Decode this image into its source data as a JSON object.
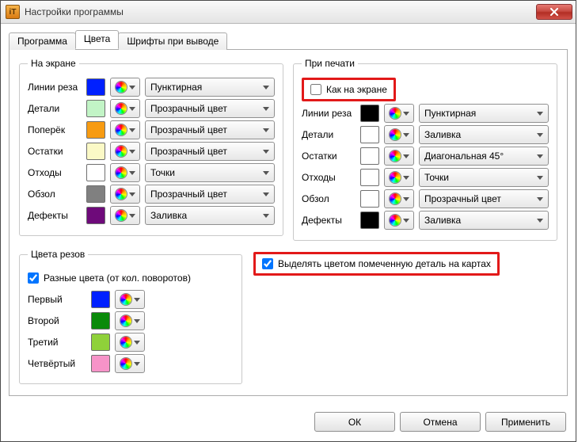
{
  "window": {
    "title": "Настройки программы"
  },
  "tabs": [
    {
      "label": "Программа"
    },
    {
      "label": "Цвета"
    },
    {
      "label": "Шрифты при выводе"
    }
  ],
  "groups": {
    "screen_title": "На экране",
    "print_title": "При печати",
    "cuts_title": "Цвета резов"
  },
  "screen_rows": [
    {
      "label": "Линии реза",
      "color": "#0020ff",
      "style": "Пунктирная"
    },
    {
      "label": "Детали",
      "color": "#c2f4c6",
      "style": "Прозрачный цвет"
    },
    {
      "label": "Поперёк",
      "color": "#f79b12",
      "style": "Прозрачный цвет"
    },
    {
      "label": "Остатки",
      "color": "#fbf9c6",
      "style": "Прозрачный цвет"
    },
    {
      "label": "Отходы",
      "color": "#ffffff",
      "style": "Точки"
    },
    {
      "label": "Обзол",
      "color": "#808080",
      "style": "Прозрачный цвет"
    },
    {
      "label": "Дефекты",
      "color": "#6e0a7a",
      "style": "Заливка"
    }
  ],
  "print_same_as_screen": {
    "label": "Как на экране",
    "checked": false
  },
  "print_rows": [
    {
      "label": "Линии реза",
      "color": "#000000",
      "style": "Пунктирная"
    },
    {
      "label": "Детали",
      "color": "#ffffff",
      "style": "Заливка"
    },
    {
      "label": "Остатки",
      "color": "#ffffff",
      "style": "Диагональная 45°"
    },
    {
      "label": "Отходы",
      "color": "#ffffff",
      "style": "Точки"
    },
    {
      "label": "Обзол",
      "color": "#ffffff",
      "style": "Прозрачный цвет"
    },
    {
      "label": "Дефекты",
      "color": "#000000",
      "style": "Заливка"
    }
  ],
  "cuts": {
    "diff_colors": {
      "label": "Разные цвета (от кол. поворотов)",
      "checked": true
    },
    "rows": [
      {
        "label": "Первый",
        "color": "#0020ff"
      },
      {
        "label": "Второй",
        "color": "#0a8a0a"
      },
      {
        "label": "Третий",
        "color": "#8fd13a"
      },
      {
        "label": "Четвёртый",
        "color": "#f693c8"
      }
    ]
  },
  "highlight": {
    "label": "Выделять цветом помеченную деталь на картах",
    "checked": true
  },
  "buttons": {
    "ok": "ОК",
    "cancel": "Отмена",
    "apply": "Применить"
  }
}
